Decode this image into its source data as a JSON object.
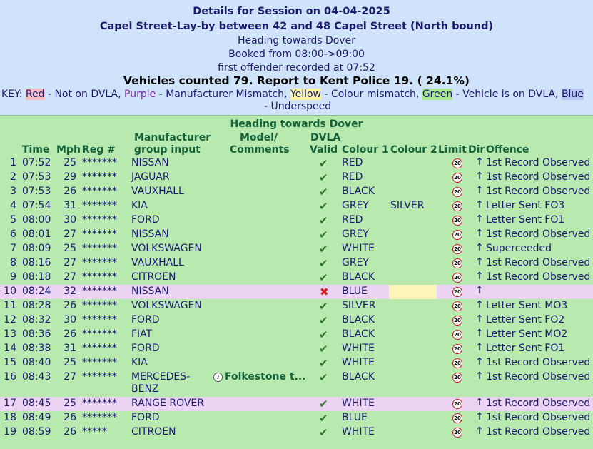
{
  "header": {
    "title": "Details for Session on 04-04-2025",
    "location": "Capel Street-Lay-by between 42 and 48 Capel Street (North bound)",
    "heading": "Heading towards Dover",
    "booked": "Booked from 08:00->09:00",
    "first_offender": "first offender recorded at 07:52",
    "counted": "Vehicles counted 79. Report to Kent Police 19. ( 24.1%)"
  },
  "key": {
    "prefix": "KEY: ",
    "red": "Red",
    "red_desc": " - Not on DVLA, ",
    "purple": "Purple",
    "purple_desc": " - Manufacturer Mismatch, ",
    "yellow": "Yellow",
    "yellow_desc": " - Colour mismatch, ",
    "green": "Green",
    "green_desc": " - Vehicle is on DVLA, ",
    "blue": "Blue",
    "line2": "- Underspeed"
  },
  "table": {
    "section_title": "Heading towards Dover",
    "columns": {
      "time": "Time",
      "mph": "Mph",
      "reg": "Reg #",
      "manufacturer_1": "Manufacturer",
      "manufacturer_2": "group input",
      "model_1": "Model/",
      "model_2": "Comments",
      "dvla_1": "DVLA",
      "dvla_2": "Valid",
      "colour1": "Colour 1",
      "colour2": "Colour 2",
      "limit": "Limit",
      "dir": "Dir",
      "offence": "Offence"
    },
    "limit_value": "20",
    "direction_glyph": "↑",
    "valid_glyph": "✔",
    "invalid_glyph": "✖",
    "info_glyph": "i",
    "rows": [
      {
        "n": "1",
        "time": "07:52",
        "mph": "25",
        "reg": "*******",
        "make": "NISSAN",
        "comment": "",
        "valid": true,
        "c1": "RED",
        "c2": "",
        "offence": "1st Record Observed",
        "highlight": false
      },
      {
        "n": "2",
        "time": "07:53",
        "mph": "29",
        "reg": "*******",
        "make": "JAGUAR",
        "comment": "",
        "valid": true,
        "c1": "RED",
        "c2": "",
        "offence": "1st Record Observed",
        "highlight": false
      },
      {
        "n": "3",
        "time": "07:53",
        "mph": "26",
        "reg": "*******",
        "make": "VAUXHALL",
        "comment": "",
        "valid": true,
        "c1": "BLACK",
        "c2": "",
        "offence": "1st Record Observed",
        "highlight": false
      },
      {
        "n": "4",
        "time": "07:54",
        "mph": "31",
        "reg": "*******",
        "make": "KIA",
        "comment": "",
        "valid": true,
        "c1": "GREY",
        "c2": "SILVER",
        "offence": "Letter Sent FO3",
        "highlight": false
      },
      {
        "n": "5",
        "time": "08:00",
        "mph": "30",
        "reg": "*******",
        "make": "FORD",
        "comment": "",
        "valid": true,
        "c1": "RED",
        "c2": "",
        "offence": "Letter Sent FO1",
        "highlight": false
      },
      {
        "n": "6",
        "time": "08:01",
        "mph": "27",
        "reg": "*******",
        "make": "NISSAN",
        "comment": "",
        "valid": true,
        "c1": "GREY",
        "c2": "",
        "offence": "1st Record Observed",
        "highlight": false
      },
      {
        "n": "7",
        "time": "08:09",
        "mph": "25",
        "reg": "*******",
        "make": "VOLKSWAGEN",
        "comment": "",
        "valid": true,
        "c1": "WHITE",
        "c2": "",
        "offence": "Superceeded",
        "highlight": false
      },
      {
        "n": "8",
        "time": "08:16",
        "mph": "27",
        "reg": "*******",
        "make": "VAUXHALL",
        "comment": "",
        "valid": true,
        "c1": "GREY",
        "c2": "",
        "offence": "1st Record Observed",
        "highlight": false
      },
      {
        "n": "9",
        "time": "08:18",
        "mph": "27",
        "reg": "*******",
        "make": "CITROEN",
        "comment": "",
        "valid": true,
        "c1": "BLACK",
        "c2": "",
        "offence": "1st Record Observed",
        "highlight": false
      },
      {
        "n": "10",
        "time": "08:24",
        "mph": "32",
        "reg": "*******",
        "make": "NISSAN",
        "comment": "",
        "valid": false,
        "c1": "BLUE",
        "c2": "",
        "offence": "",
        "highlight": true
      },
      {
        "n": "11",
        "time": "08:28",
        "mph": "26",
        "reg": "*******",
        "make": "VOLKSWAGEN",
        "comment": "",
        "valid": true,
        "c1": "SILVER",
        "c2": "",
        "offence": "Letter Sent MO3",
        "highlight": false
      },
      {
        "n": "12",
        "time": "08:32",
        "mph": "30",
        "reg": "*******",
        "make": "FORD",
        "comment": "",
        "valid": true,
        "c1": "BLACK",
        "c2": "",
        "offence": "Letter Sent FO2",
        "highlight": false
      },
      {
        "n": "13",
        "time": "08:36",
        "mph": "26",
        "reg": "*******",
        "make": "FIAT",
        "comment": "",
        "valid": true,
        "c1": "BLACK",
        "c2": "",
        "offence": "Letter Sent MO2",
        "highlight": false
      },
      {
        "n": "14",
        "time": "08:38",
        "mph": "31",
        "reg": "*******",
        "make": "FORD",
        "comment": "",
        "valid": true,
        "c1": "WHITE",
        "c2": "",
        "offence": "Letter Sent FO1",
        "highlight": false
      },
      {
        "n": "15",
        "time": "08:40",
        "mph": "25",
        "reg": "*******",
        "make": "KIA",
        "comment": "",
        "valid": true,
        "c1": "WHITE",
        "c2": "",
        "offence": "1st Record Observed",
        "highlight": false
      },
      {
        "n": "16",
        "time": "08:43",
        "mph": "27",
        "reg": "*******",
        "make": "MERCEDES-",
        "make2": "BENZ",
        "comment": "Folkestone t...",
        "valid": true,
        "c1": "BLACK",
        "c2": "",
        "offence": "1st Record Observed",
        "highlight": false
      },
      {
        "n": "17",
        "time": "08:45",
        "mph": "25",
        "reg": "*******",
        "make": "RANGE ROVER",
        "comment": "",
        "valid": true,
        "c1": "WHITE",
        "c2": "",
        "offence": "1st Record Observed",
        "highlight": true
      },
      {
        "n": "18",
        "time": "08:49",
        "mph": "26",
        "reg": "*******",
        "make": "FORD",
        "comment": "",
        "valid": true,
        "c1": "BLUE",
        "c2": "",
        "offence": "1st Record Observed",
        "highlight": false
      },
      {
        "n": "19",
        "time": "08:59",
        "mph": "26",
        "reg": "*****",
        "make": "CITROEN",
        "comment": "",
        "valid": true,
        "c1": "WHITE",
        "c2": "",
        "offence": "1st Record Observed",
        "highlight": false
      }
    ]
  }
}
